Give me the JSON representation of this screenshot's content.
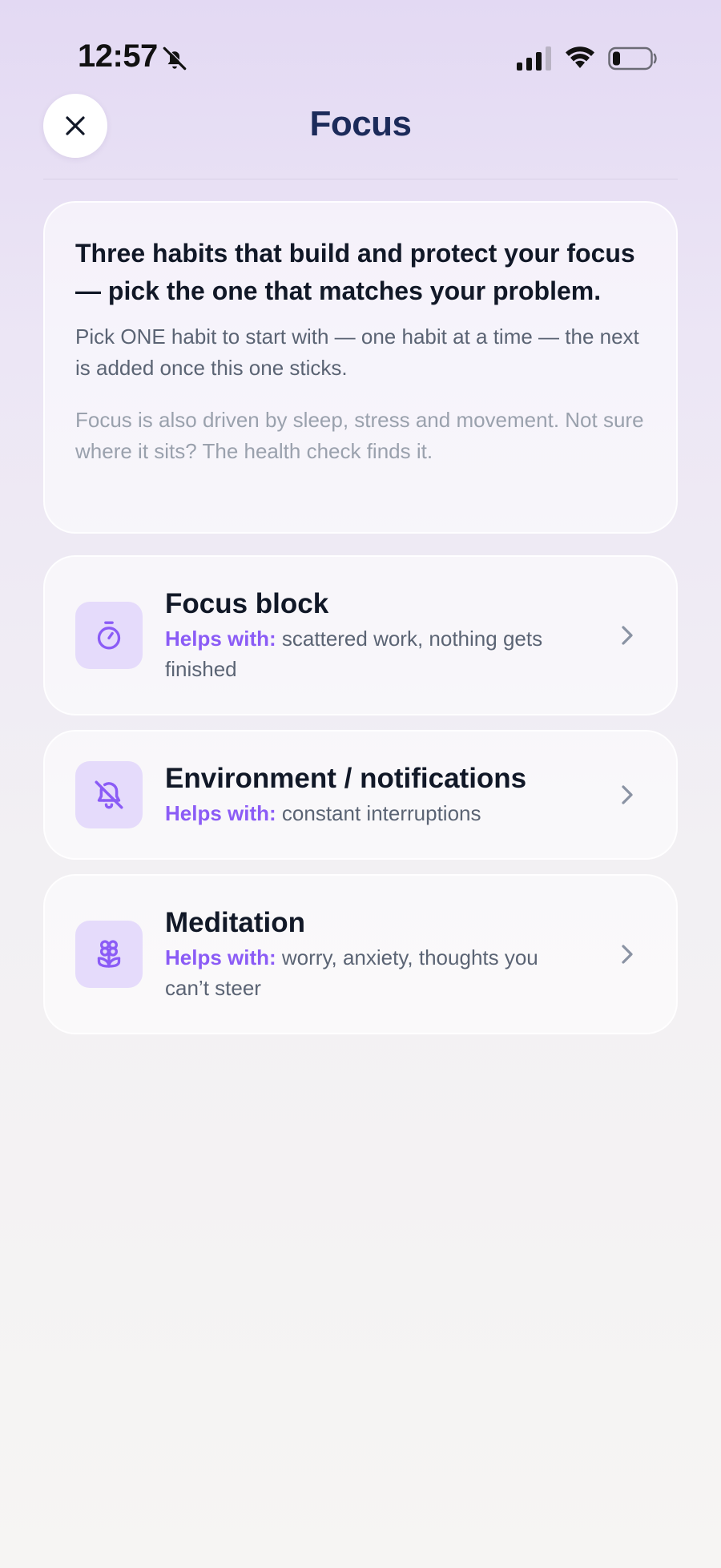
{
  "status_bar": {
    "time": "12:57"
  },
  "header": {
    "title": "Focus"
  },
  "intro": {
    "heading": "Three habits that build and protect your focus — pick the one that matches your problem.",
    "body": "Pick ONE habit to start with — one habit at a time — the next is added once this one sticks.",
    "note": "Focus is also driven by sleep, stress and movement. Not sure where it sits? The health check finds it."
  },
  "habits": [
    {
      "title": "Focus block",
      "helps_label": "Helps with:",
      "helps_text": "scattered work, nothing gets finished",
      "icon": "stopwatch-icon"
    },
    {
      "title": "Environment / notifications",
      "helps_label": "Helps with:",
      "helps_text": "constant interruptions",
      "icon": "bell-off-icon"
    },
    {
      "title": "Meditation",
      "helps_label": "Helps with:",
      "helps_text": "worry, anxiety, thoughts you can’t steer",
      "icon": "flower-icon"
    }
  ],
  "colors": {
    "accent": "#8b5cf6",
    "icon_bg": "#e5dbfb",
    "title": "#1c2b5a"
  }
}
